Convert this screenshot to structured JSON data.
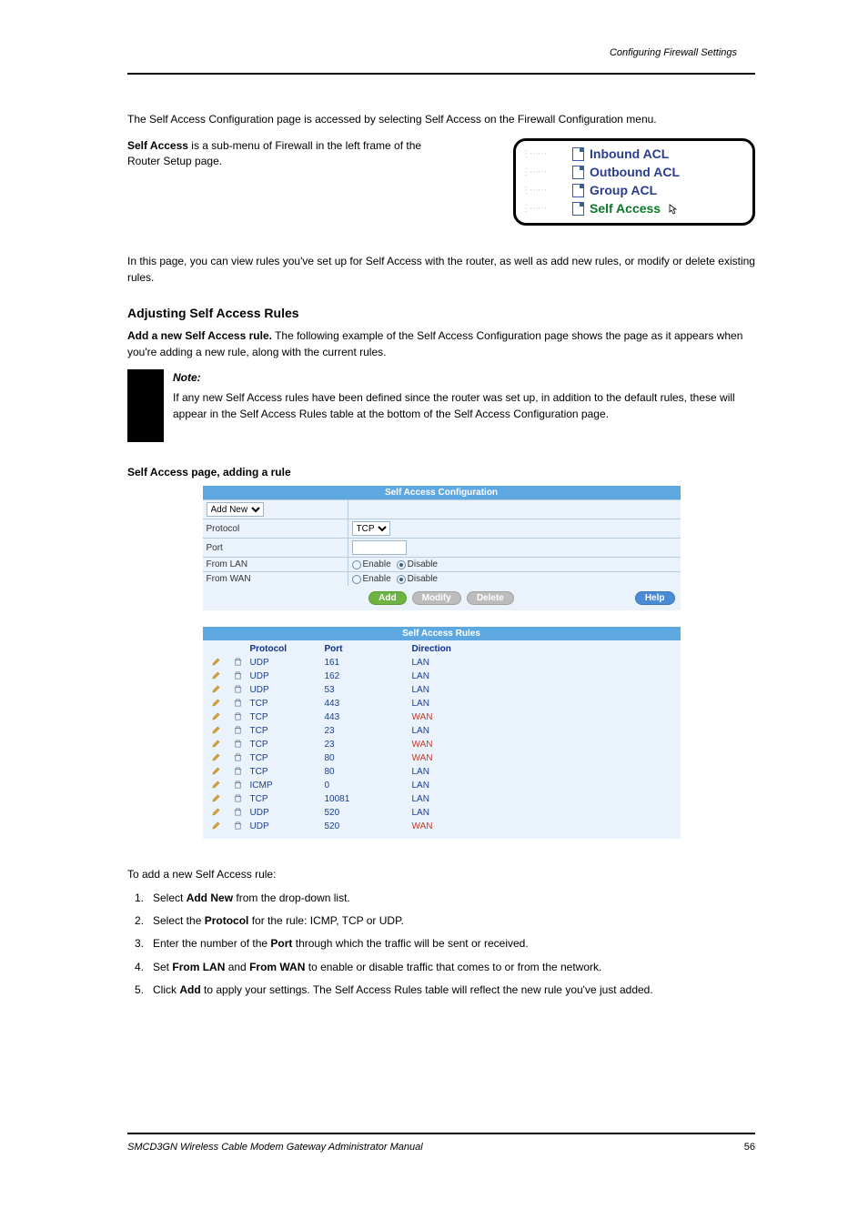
{
  "header": {
    "right_text": "Configuring Firewall Settings"
  },
  "intro_text": "The Self Access Configuration page is accessed by selecting Self Access on the Firewall Configuration menu.",
  "submenu": {
    "prefix": "Self Access",
    "rest": " is a sub-menu of Firewall in the left frame of the Router Setup page.",
    "items": [
      {
        "label": "Inbound ACL",
        "active": false
      },
      {
        "label": "Outbound ACL",
        "active": false
      },
      {
        "label": "Group ACL",
        "active": false
      },
      {
        "label": "Self Access",
        "active": true
      }
    ]
  },
  "body_paragraphs": [
    {
      "text": "In this page, you can view rules you've set up for Self Access with the router, as well as add new rules, or modify or delete existing rules."
    },
    {
      "prefix": "",
      "strong": "Add a new Self Access rule.",
      "rest": " The following example of the Self Access Configuration page shows the page as it appears when you're adding a new rule, along with the current rules."
    }
  ],
  "section_heading": "Adjusting Self Access Rules",
  "note": {
    "label": "Note:",
    "text": "If any new Self Access rules have been defined since the router was set up, in addition to the default rules, these will appear in the Self Access Rules table at the bottom of the Self Access Configuration page."
  },
  "fig_caption_top": "Self Access page, adding a rule",
  "config_panel": {
    "title": "Self Access Configuration",
    "rows": {
      "mode": {
        "label": "",
        "select": "Add New"
      },
      "protocol": {
        "label": "Protocol",
        "select": "TCP"
      },
      "port": {
        "label": "Port",
        "value": ""
      },
      "from_lan": {
        "label": "From LAN",
        "enable": "Enable",
        "disable": "Disable",
        "selected": "disable"
      },
      "from_wan": {
        "label": "From WAN",
        "enable": "Enable",
        "disable": "Disable",
        "selected": "disable"
      }
    },
    "buttons": {
      "add": "Add",
      "modify": "Modify",
      "delete": "Delete",
      "help": "Help"
    }
  },
  "rules_panel": {
    "title": "Self Access Rules",
    "headers": {
      "protocol": "Protocol",
      "port": "Port",
      "direction": "Direction"
    },
    "rows": [
      {
        "protocol": "UDP",
        "port": "161",
        "direction": "LAN"
      },
      {
        "protocol": "UDP",
        "port": "162",
        "direction": "LAN"
      },
      {
        "protocol": "UDP",
        "port": "53",
        "direction": "LAN"
      },
      {
        "protocol": "TCP",
        "port": "443",
        "direction": "LAN"
      },
      {
        "protocol": "TCP",
        "port": "443",
        "direction": "WAN"
      },
      {
        "protocol": "TCP",
        "port": "23",
        "direction": "LAN"
      },
      {
        "protocol": "TCP",
        "port": "23",
        "direction": "WAN"
      },
      {
        "protocol": "TCP",
        "port": "80",
        "direction": "WAN"
      },
      {
        "protocol": "TCP",
        "port": "80",
        "direction": "LAN"
      },
      {
        "protocol": "ICMP",
        "port": "0",
        "direction": "LAN"
      },
      {
        "protocol": "TCP",
        "port": "10081",
        "direction": "LAN"
      },
      {
        "protocol": "UDP",
        "port": "520",
        "direction": "LAN"
      },
      {
        "protocol": "UDP",
        "port": "520",
        "direction": "WAN"
      }
    ]
  },
  "after_fig": "To add a new Self Access rule:",
  "steps": [
    {
      "n": "1.",
      "prefix": "Select ",
      "strong": "Add New",
      "rest": " from the drop-down list."
    },
    {
      "n": "2.",
      "prefix": "Select the ",
      "strong": "Protocol",
      "rest": " for the rule: ICMP, TCP or UDP."
    },
    {
      "n": "3.",
      "prefix": "Enter the number of the ",
      "strong": "Port",
      "rest": " through which the traffic will be sent or received."
    },
    {
      "n": "4.",
      "prefix_a": "Set ",
      "strong_a": "From LAN",
      "mid": " and ",
      "strong_b": "From WAN",
      "suffix": " to enable or disable traffic that comes to or from the network."
    },
    {
      "n": "5.",
      "prefix": "Click ",
      "strong": "Add",
      "rest": " to apply your settings. The Self Access Rules table will reflect the new rule you've just added."
    }
  ],
  "footer": {
    "left": "SMCD3GN Wireless Cable Modem Gateway Administrator Manual",
    "right": "56"
  }
}
